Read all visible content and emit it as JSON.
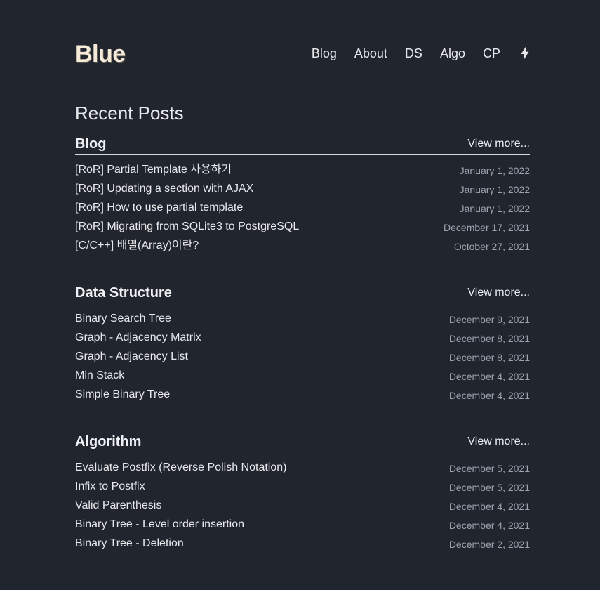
{
  "header": {
    "logo": "Blue",
    "nav": [
      "Blog",
      "About",
      "DS",
      "Algo",
      "CP"
    ],
    "bolt_icon": "lightning-bolt-icon"
  },
  "main": {
    "heading": "Recent Posts",
    "sections": [
      {
        "title": "Blog",
        "view_more": "View more...",
        "posts": [
          {
            "title": "[RoR] Partial Template 사용하기",
            "date": "January 1, 2022"
          },
          {
            "title": "[RoR] Updating a section with AJAX",
            "date": "January 1, 2022"
          },
          {
            "title": "[RoR] How to use partial template",
            "date": "January 1, 2022"
          },
          {
            "title": "[RoR] Migrating from SQLite3 to PostgreSQL",
            "date": "December 17, 2021"
          },
          {
            "title": "[C/C++] 배열(Array)이란?",
            "date": "October 27, 2021"
          }
        ]
      },
      {
        "title": "Data Structure",
        "view_more": "View more...",
        "posts": [
          {
            "title": "Binary Search Tree",
            "date": "December 9, 2021"
          },
          {
            "title": "Graph - Adjacency Matrix",
            "date": "December 8, 2021"
          },
          {
            "title": "Graph - Adjacency List",
            "date": "December 8, 2021"
          },
          {
            "title": "Min Stack",
            "date": "December 4, 2021"
          },
          {
            "title": "Simple Binary Tree",
            "date": "December 4, 2021"
          }
        ]
      },
      {
        "title": "Algorithm",
        "view_more": "View more...",
        "posts": [
          {
            "title": "Evaluate Postfix (Reverse Polish Notation)",
            "date": "December 5, 2021"
          },
          {
            "title": "Infix to Postfix",
            "date": "December 5, 2021"
          },
          {
            "title": "Valid Parenthesis",
            "date": "December 4, 2021"
          },
          {
            "title": "Binary Tree - Level order insertion",
            "date": "December 4, 2021"
          },
          {
            "title": "Binary Tree - Deletion",
            "date": "December 2, 2021"
          }
        ]
      }
    ]
  },
  "colors": {
    "background": "#21252e",
    "logo": "#f6ead8",
    "text": "#e8e9ec",
    "date": "#9ea3ad"
  }
}
